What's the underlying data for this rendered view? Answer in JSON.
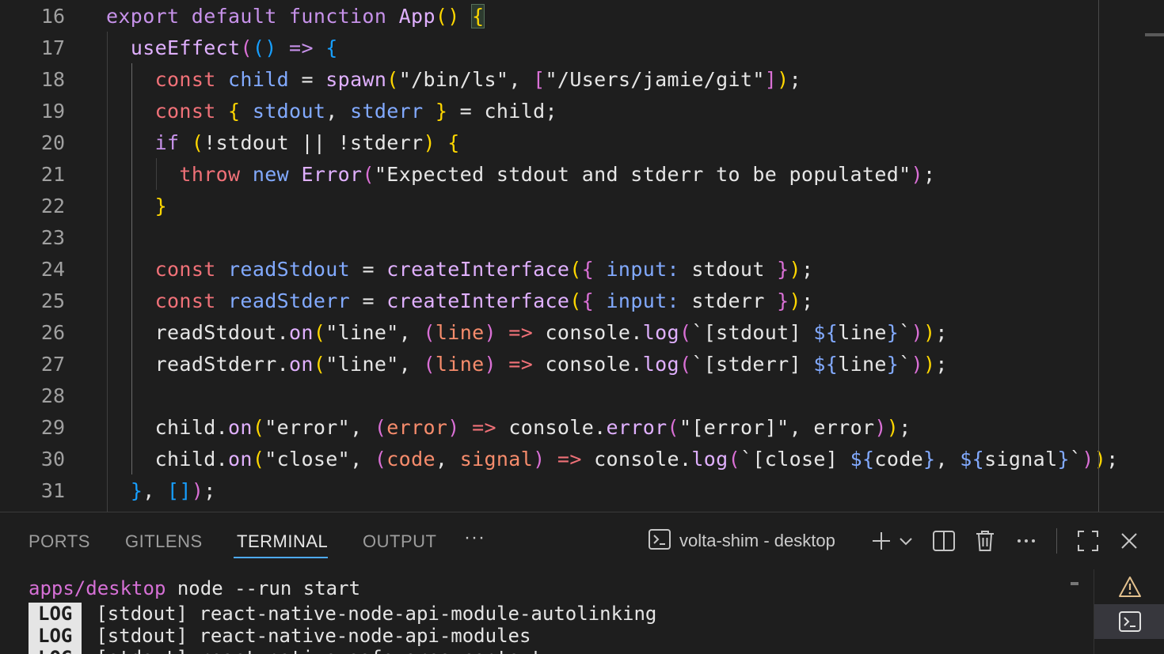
{
  "editor": {
    "lines": [
      {
        "n": "16",
        "tokens": [
          [
            "export default function ",
            "kw2"
          ],
          [
            "App",
            "fn"
          ],
          [
            "(",
            "b1"
          ],
          [
            ")",
            "b1"
          ],
          [
            " ",
            ""
          ],
          [
            "{",
            "b1 curly-hl"
          ]
        ]
      },
      {
        "n": "17",
        "tokens": [
          [
            "  ",
            ""
          ],
          [
            "useEffect",
            "fn"
          ],
          [
            "(",
            "b2"
          ],
          [
            "()",
            "b3"
          ],
          [
            " => ",
            "kw2"
          ],
          [
            "{",
            "b3"
          ]
        ]
      },
      {
        "n": "18",
        "tokens": [
          [
            "    ",
            ""
          ],
          [
            "const ",
            "kw"
          ],
          [
            "child",
            "var"
          ],
          [
            " = ",
            "txt"
          ],
          [
            "spawn",
            "fn"
          ],
          [
            "(",
            "b1"
          ],
          [
            "\"/bin/ls\"",
            "txt"
          ],
          [
            ", ",
            "txt"
          ],
          [
            "[",
            "b2"
          ],
          [
            "\"/Users/jamie/git\"",
            "txt"
          ],
          [
            "]",
            "b2"
          ],
          [
            ")",
            "b1"
          ],
          [
            ";",
            "txt"
          ]
        ]
      },
      {
        "n": "19",
        "tokens": [
          [
            "    ",
            ""
          ],
          [
            "const ",
            "kw"
          ],
          [
            "{",
            "b1"
          ],
          [
            " stdout",
            "var"
          ],
          [
            ", ",
            "txt"
          ],
          [
            "stderr ",
            "var"
          ],
          [
            "}",
            "b1"
          ],
          [
            " = child;",
            "txt"
          ]
        ]
      },
      {
        "n": "20",
        "tokens": [
          [
            "    ",
            ""
          ],
          [
            "if ",
            "kw2"
          ],
          [
            "(",
            "b1"
          ],
          [
            "!stdout || !stderr",
            "txt"
          ],
          [
            ")",
            "b1"
          ],
          [
            " ",
            ""
          ],
          [
            "{",
            "b1"
          ]
        ]
      },
      {
        "n": "21",
        "tokens": [
          [
            "      ",
            ""
          ],
          [
            "throw ",
            "kw"
          ],
          [
            "new ",
            "var"
          ],
          [
            "Error",
            "fn"
          ],
          [
            "(",
            "b2"
          ],
          [
            "\"Expected stdout and stderr to be populated\"",
            "txt"
          ],
          [
            ")",
            "b2"
          ],
          [
            ";",
            "txt"
          ]
        ]
      },
      {
        "n": "22",
        "tokens": [
          [
            "    ",
            ""
          ],
          [
            "}",
            "b1"
          ]
        ]
      },
      {
        "n": "23",
        "tokens": [
          [
            "",
            ""
          ]
        ]
      },
      {
        "n": "24",
        "tokens": [
          [
            "    ",
            ""
          ],
          [
            "const ",
            "kw"
          ],
          [
            "readStdout",
            "var"
          ],
          [
            " = ",
            "txt"
          ],
          [
            "createInterface",
            "fn"
          ],
          [
            "(",
            "b1"
          ],
          [
            "{",
            "b2"
          ],
          [
            " input: ",
            "prop"
          ],
          [
            "stdout ",
            "txt"
          ],
          [
            "}",
            "b2"
          ],
          [
            ")",
            "b1"
          ],
          [
            ";",
            "txt"
          ]
        ]
      },
      {
        "n": "25",
        "tokens": [
          [
            "    ",
            ""
          ],
          [
            "const ",
            "kw"
          ],
          [
            "readStderr",
            "var"
          ],
          [
            " = ",
            "txt"
          ],
          [
            "createInterface",
            "fn"
          ],
          [
            "(",
            "b1"
          ],
          [
            "{",
            "b2"
          ],
          [
            " input: ",
            "prop"
          ],
          [
            "stderr ",
            "txt"
          ],
          [
            "}",
            "b2"
          ],
          [
            ")",
            "b1"
          ],
          [
            ";",
            "txt"
          ]
        ]
      },
      {
        "n": "26",
        "tokens": [
          [
            "    ",
            ""
          ],
          [
            "readStdout.",
            "txt"
          ],
          [
            "on",
            "fn"
          ],
          [
            "(",
            "b1"
          ],
          [
            "\"line\"",
            "txt"
          ],
          [
            ", ",
            "txt"
          ],
          [
            "(",
            "b2"
          ],
          [
            "line",
            "prm"
          ],
          [
            ")",
            "b2"
          ],
          [
            " => ",
            "kw"
          ],
          [
            "console.",
            "txt"
          ],
          [
            "log",
            "fn"
          ],
          [
            "(",
            "b2"
          ],
          [
            "`[stdout] ",
            "txt"
          ],
          [
            "${",
            "var"
          ],
          [
            "line",
            "txt"
          ],
          [
            "}",
            "var"
          ],
          [
            "`",
            "txt"
          ],
          [
            ")",
            "b2"
          ],
          [
            ")",
            "b1"
          ],
          [
            ";",
            "txt"
          ]
        ]
      },
      {
        "n": "27",
        "tokens": [
          [
            "    ",
            ""
          ],
          [
            "readStderr.",
            "txt"
          ],
          [
            "on",
            "fn"
          ],
          [
            "(",
            "b1"
          ],
          [
            "\"line\"",
            "txt"
          ],
          [
            ", ",
            "txt"
          ],
          [
            "(",
            "b2"
          ],
          [
            "line",
            "prm"
          ],
          [
            ")",
            "b2"
          ],
          [
            " => ",
            "kw"
          ],
          [
            "console.",
            "txt"
          ],
          [
            "log",
            "fn"
          ],
          [
            "(",
            "b2"
          ],
          [
            "`[stderr] ",
            "txt"
          ],
          [
            "${",
            "var"
          ],
          [
            "line",
            "txt"
          ],
          [
            "}",
            "var"
          ],
          [
            "`",
            "txt"
          ],
          [
            ")",
            "b2"
          ],
          [
            ")",
            "b1"
          ],
          [
            ";",
            "txt"
          ]
        ]
      },
      {
        "n": "28",
        "tokens": [
          [
            "",
            ""
          ]
        ]
      },
      {
        "n": "29",
        "tokens": [
          [
            "    ",
            ""
          ],
          [
            "child.",
            "txt"
          ],
          [
            "on",
            "fn"
          ],
          [
            "(",
            "b1"
          ],
          [
            "\"error\"",
            "txt"
          ],
          [
            ", ",
            "txt"
          ],
          [
            "(",
            "b2"
          ],
          [
            "error",
            "prm"
          ],
          [
            ")",
            "b2"
          ],
          [
            " => ",
            "kw"
          ],
          [
            "console.",
            "txt"
          ],
          [
            "error",
            "fn"
          ],
          [
            "(",
            "b2"
          ],
          [
            "\"[error]\"",
            "txt"
          ],
          [
            ", error",
            "txt"
          ],
          [
            ")",
            "b2"
          ],
          [
            ")",
            "b1"
          ],
          [
            ";",
            "txt"
          ]
        ]
      },
      {
        "n": "30",
        "tokens": [
          [
            "    ",
            ""
          ],
          [
            "child.",
            "txt"
          ],
          [
            "on",
            "fn"
          ],
          [
            "(",
            "b1"
          ],
          [
            "\"close\"",
            "txt"
          ],
          [
            ", ",
            "txt"
          ],
          [
            "(",
            "b2"
          ],
          [
            "code",
            "prm"
          ],
          [
            ", ",
            "txt"
          ],
          [
            "signal",
            "prm"
          ],
          [
            ")",
            "b2"
          ],
          [
            " => ",
            "kw"
          ],
          [
            "console.",
            "txt"
          ],
          [
            "log",
            "fn"
          ],
          [
            "(",
            "b2"
          ],
          [
            "`[close] ",
            "txt"
          ],
          [
            "${",
            "var"
          ],
          [
            "code",
            "txt"
          ],
          [
            "}",
            "var"
          ],
          [
            ", ",
            "txt"
          ],
          [
            "${",
            "var"
          ],
          [
            "signal",
            "txt"
          ],
          [
            "}",
            "var"
          ],
          [
            "`",
            "txt"
          ],
          [
            ")",
            "b2"
          ],
          [
            ")",
            "b1"
          ],
          [
            ";",
            "txt"
          ]
        ]
      },
      {
        "n": "31",
        "tokens": [
          [
            "  ",
            ""
          ],
          [
            "}",
            "b3"
          ],
          [
            ", ",
            "txt"
          ],
          [
            "[]",
            "b3"
          ],
          [
            ")",
            "b2"
          ],
          [
            ";",
            "txt"
          ]
        ]
      }
    ]
  },
  "panel": {
    "tabs": [
      {
        "label": "PORTS",
        "active": false
      },
      {
        "label": "GITLENS",
        "active": false
      },
      {
        "label": "TERMINAL",
        "active": true
      },
      {
        "label": "OUTPUT",
        "active": false
      }
    ],
    "more_label": "···",
    "terminal_name": "volta-shim - desktop",
    "terminal": {
      "prompt_path": "apps/desktop",
      "command": " node --run start",
      "log_badge": "LOG",
      "logs": [
        "[stdout] react-native-node-api-module-autolinking",
        "[stdout] react-native-node-api-modules",
        "[stdout] react-native-safe-area-context"
      ]
    }
  },
  "icons": {
    "terminal_selector": "terminal-icon",
    "new_terminal": "plus-icon",
    "dropdown": "chevron-down-icon",
    "split": "split-editor-icon",
    "kill": "trash-icon",
    "more": "ellipsis-icon",
    "maximize": "maximize-icon",
    "close": "close-icon",
    "side_warning": "warning-icon",
    "side_terminal": "terminal-icon"
  }
}
